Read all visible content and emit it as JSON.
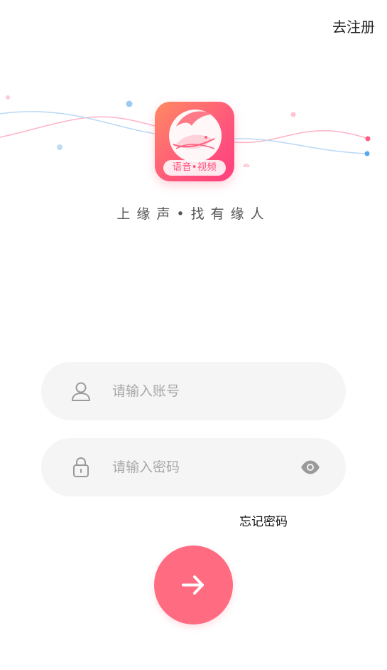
{
  "header": {
    "register_label": "去注册"
  },
  "logo": {
    "badge_text": "语音•视频"
  },
  "slogan": "上缘声•找有缘人",
  "form": {
    "account_placeholder": "请输入账号",
    "account_value": "",
    "password_placeholder": "请输入密码",
    "password_value": "",
    "forgot_label": "忘记密码"
  },
  "colors": {
    "accent": "#ff6b81",
    "wave_pink": "#ff8aa8",
    "wave_blue": "#8cc1f0"
  },
  "icons": {
    "account": "user-icon",
    "password": "lock-icon",
    "visibility": "eye-icon",
    "submit": "arrow-right-icon"
  }
}
